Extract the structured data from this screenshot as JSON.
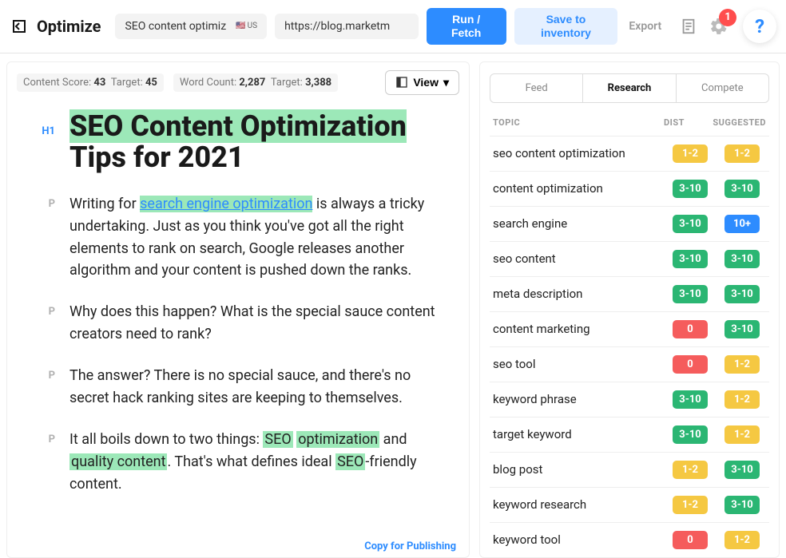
{
  "header": {
    "app_title": "Optimize",
    "keyword_input": "SEO content optimiz",
    "locale": "US",
    "url_input": "https://blog.marketm",
    "run_button": "Run / Fetch",
    "save_button": "Save to inventory",
    "export_label": "Export",
    "notification_count": "1"
  },
  "editor": {
    "content_score_label": "Content Score:",
    "content_score": "43",
    "target_score_label": "Target:",
    "target_score": "45",
    "word_count_label": "Word Count:",
    "word_count": "2,287",
    "target_words_label": "Target:",
    "target_words": "3,388",
    "view_button": "View",
    "copy_link": "Copy for Publishing",
    "h1_tag": "H1",
    "p_tag": "P",
    "h1_hl1": "SEO Content ",
    "h1_hl2": "Optimization",
    "h1_rest": " Tips for 2021",
    "p1_a": "Writing for ",
    "p1_link": "search engine optimization",
    "p1_b": " is always a tricky undertaking. Just as you think you've got all the right elements to rank on search, Google releases another algorithm and your content is pushed down the ranks.",
    "p2": "Why does this happen? What is the special sauce content creators need to rank?",
    "p3": "The answer? There is no special sauce, and there's no secret hack ranking sites are keeping to themselves.",
    "p4_a": "It all boils down to two things: ",
    "p4_hl1": "SEO",
    "p4_sp": " ",
    "p4_hl2": "optimization",
    "p4_b": " and ",
    "p4_hl3": "quality content",
    "p4_c": ". That's what defines ideal ",
    "p4_hl4": "SEO",
    "p4_d": "-friendly content."
  },
  "sidebar": {
    "tabs": {
      "feed": "Feed",
      "research": "Research",
      "compete": "Compete"
    },
    "cols": {
      "topic": "TOPIC",
      "dist": "DIST",
      "sugg": "SUGGESTED"
    },
    "rows": [
      {
        "name": "seo content optimization",
        "dist": "1-2",
        "dc": "yellow",
        "sugg": "1-2",
        "sc": "yellow"
      },
      {
        "name": "content optimization",
        "dist": "3-10",
        "dc": "green",
        "sugg": "3-10",
        "sc": "green"
      },
      {
        "name": "search engine",
        "dist": "3-10",
        "dc": "green",
        "sugg": "10+",
        "sc": "blue"
      },
      {
        "name": "seo content",
        "dist": "3-10",
        "dc": "green",
        "sugg": "3-10",
        "sc": "green"
      },
      {
        "name": "meta description",
        "dist": "3-10",
        "dc": "green",
        "sugg": "3-10",
        "sc": "green"
      },
      {
        "name": "content marketing",
        "dist": "0",
        "dc": "red",
        "sugg": "3-10",
        "sc": "green"
      },
      {
        "name": "seo tool",
        "dist": "0",
        "dc": "red",
        "sugg": "1-2",
        "sc": "yellow"
      },
      {
        "name": "keyword phrase",
        "dist": "3-10",
        "dc": "green",
        "sugg": "1-2",
        "sc": "yellow"
      },
      {
        "name": "target keyword",
        "dist": "3-10",
        "dc": "green",
        "sugg": "1-2",
        "sc": "yellow"
      },
      {
        "name": "blog post",
        "dist": "1-2",
        "dc": "yellow",
        "sugg": "3-10",
        "sc": "green"
      },
      {
        "name": "keyword research",
        "dist": "1-2",
        "dc": "yellow",
        "sugg": "3-10",
        "sc": "green"
      },
      {
        "name": "keyword tool",
        "dist": "0",
        "dc": "red",
        "sugg": "1-2",
        "sc": "yellow"
      }
    ]
  }
}
